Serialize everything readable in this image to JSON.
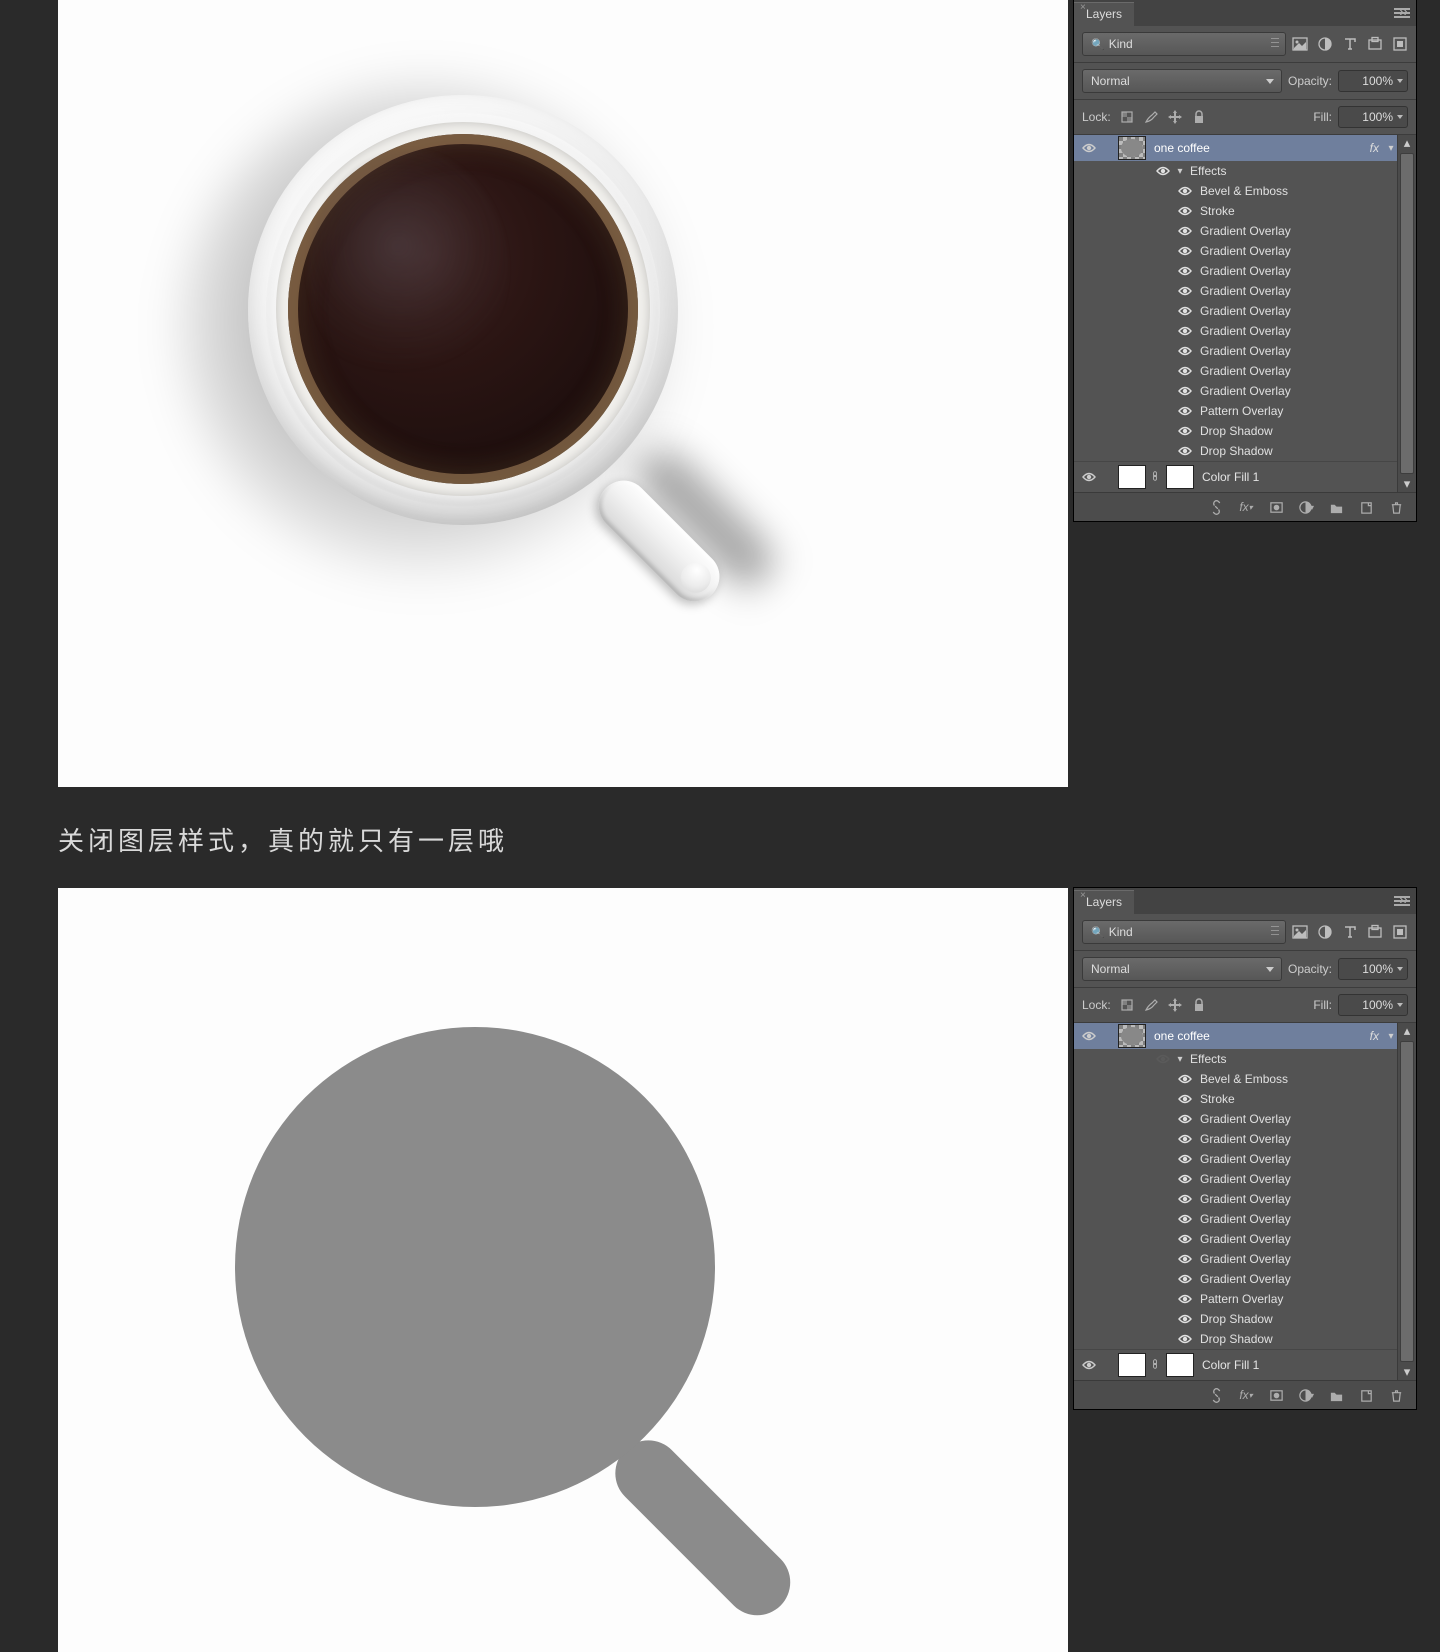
{
  "caption": "关闭图层样式，真的就只有一层哦",
  "panel_a": {
    "tab": "Layers",
    "kind_label": "Kind",
    "blend_mode": "Normal",
    "opacity_label": "Opacity:",
    "opacity_value": "100%",
    "lock_label": "Lock:",
    "fill_label": "Fill:",
    "fill_value": "100%",
    "layer_main": "one coffee",
    "fx": "fx",
    "effects_label": "Effects",
    "effects": [
      "Bevel & Emboss",
      "Stroke",
      "Gradient Overlay",
      "Gradient Overlay",
      "Gradient Overlay",
      "Gradient Overlay",
      "Gradient Overlay",
      "Gradient Overlay",
      "Gradient Overlay",
      "Gradient Overlay",
      "Gradient Overlay",
      "Pattern Overlay",
      "Drop Shadow",
      "Drop Shadow"
    ],
    "layer_bg": "Color Fill 1",
    "effects_visible": true
  },
  "panel_b": {
    "tab": "Layers",
    "kind_label": "Kind",
    "blend_mode": "Normal",
    "opacity_label": "Opacity:",
    "opacity_value": "100%",
    "lock_label": "Lock:",
    "fill_label": "Fill:",
    "fill_value": "100%",
    "layer_main": "one coffee",
    "fx": "fx",
    "effects_label": "Effects",
    "effects": [
      "Bevel & Emboss",
      "Stroke",
      "Gradient Overlay",
      "Gradient Overlay",
      "Gradient Overlay",
      "Gradient Overlay",
      "Gradient Overlay",
      "Gradient Overlay",
      "Gradient Overlay",
      "Gradient Overlay",
      "Gradient Overlay",
      "Pattern Overlay",
      "Drop Shadow",
      "Drop Shadow"
    ],
    "layer_bg": "Color Fill 1",
    "effects_visible": false
  },
  "icons": {
    "filter_image": "image",
    "filter_adjust": "adjust",
    "filter_type": "type",
    "filter_shape": "shape",
    "filter_smart": "smart",
    "filter_none": "none"
  },
  "footer_icons": [
    "link",
    "fx",
    "mask",
    "adjust",
    "group",
    "new",
    "trash"
  ]
}
